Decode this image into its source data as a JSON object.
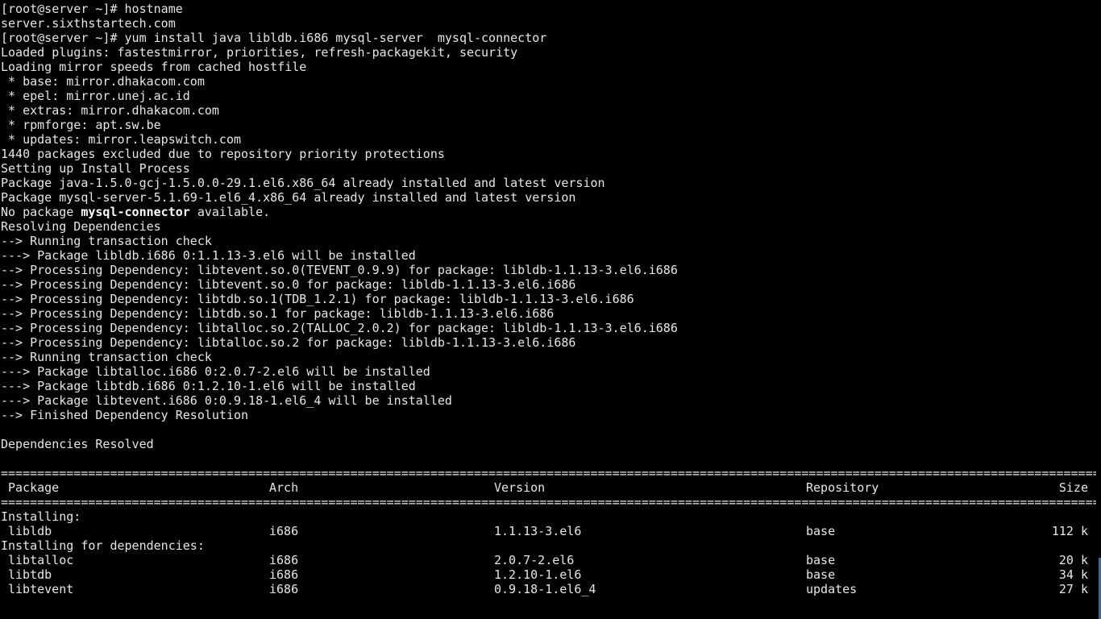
{
  "terminal": {
    "lines": [
      "[root@server ~]# hostname",
      "server.sixthstartech.com",
      "[root@server ~]# yum install java libldb.i686 mysql-server  mysql-connector",
      "Loaded plugins: fastestmirror, priorities, refresh-packagekit, security",
      "Loading mirror speeds from cached hostfile",
      " * base: mirror.dhakacom.com",
      " * epel: mirror.unej.ac.id",
      " * extras: mirror.dhakacom.com",
      " * rpmforge: apt.sw.be",
      " * updates: mirror.leapswitch.com",
      "1440 packages excluded due to repository priority protections",
      "Setting up Install Process",
      "Package java-1.5.0-gcj-1.5.0.0-29.1.el6.x86_64 already installed and latest version",
      "Package mysql-server-5.1.69-1.el6_4.x86_64 already installed and latest version"
    ],
    "no_package": {
      "prefix": "No package ",
      "name": "mysql-connector",
      "suffix": " available."
    },
    "lines2": [
      "Resolving Dependencies",
      "--> Running transaction check",
      "---> Package libldb.i686 0:1.1.13-3.el6 will be installed",
      "--> Processing Dependency: libtevent.so.0(TEVENT_0.9.9) for package: libldb-1.1.13-3.el6.i686",
      "--> Processing Dependency: libtevent.so.0 for package: libldb-1.1.13-3.el6.i686",
      "--> Processing Dependency: libtdb.so.1(TDB_1.2.1) for package: libldb-1.1.13-3.el6.i686",
      "--> Processing Dependency: libtdb.so.1 for package: libldb-1.1.13-3.el6.i686",
      "--> Processing Dependency: libtalloc.so.2(TALLOC_2.0.2) for package: libldb-1.1.13-3.el6.i686",
      "--> Processing Dependency: libtalloc.so.2 for package: libldb-1.1.13-3.el6.i686",
      "--> Running transaction check",
      "---> Package libtalloc.i686 0:2.0.7-2.el6 will be installed",
      "---> Package libtdb.i686 0:1.2.10-1.el6 will be installed",
      "---> Package libtevent.i686 0:0.9.18-1.el6_4 will be installed",
      "--> Finished Dependency Resolution",
      "",
      "Dependencies Resolved",
      ""
    ],
    "separator": "================================================================================================================================================================",
    "table": {
      "headers": {
        "package": "Package",
        "arch": "Arch",
        "version": "Version",
        "repository": "Repository",
        "size": "Size"
      },
      "installing_label": "Installing:",
      "installing": [
        {
          "package": "libldb",
          "arch": "i686",
          "version": "1.1.13-3.el6",
          "repository": "base",
          "size": "112 k"
        }
      ],
      "deps_label": "Installing for dependencies:",
      "deps": [
        {
          "package": "libtalloc",
          "arch": "i686",
          "version": "2.0.7-2.el6",
          "repository": "base",
          "size": "20 k"
        },
        {
          "package": "libtdb",
          "arch": "i686",
          "version": "1.2.10-1.el6",
          "repository": "base",
          "size": "34 k"
        },
        {
          "package": "libtevent",
          "arch": "i686",
          "version": "0.9.18-1.el6_4",
          "repository": "updates",
          "size": "27 k"
        }
      ]
    }
  }
}
